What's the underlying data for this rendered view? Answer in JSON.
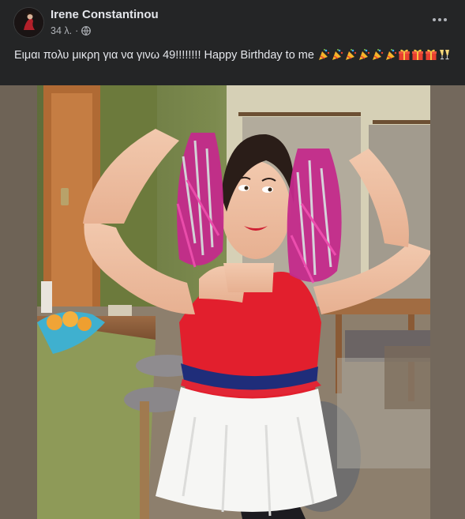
{
  "post": {
    "author": "Irene Constantinou",
    "time": "34 λ.",
    "separator": "·",
    "audience_icon": "globe-icon",
    "caption": "Ειμαι πολυ μικρη για να γινω 49!!!!!!!! Happy Birthday to me",
    "emojis": [
      "party-popper",
      "party-popper",
      "party-popper",
      "party-popper",
      "party-popper",
      "party-popper",
      "gift",
      "gift",
      "gift",
      "clinking-glasses"
    ]
  },
  "colors": {
    "background": "#242526",
    "text_primary": "#e4e6eb",
    "text_secondary": "#b0b3b8"
  }
}
